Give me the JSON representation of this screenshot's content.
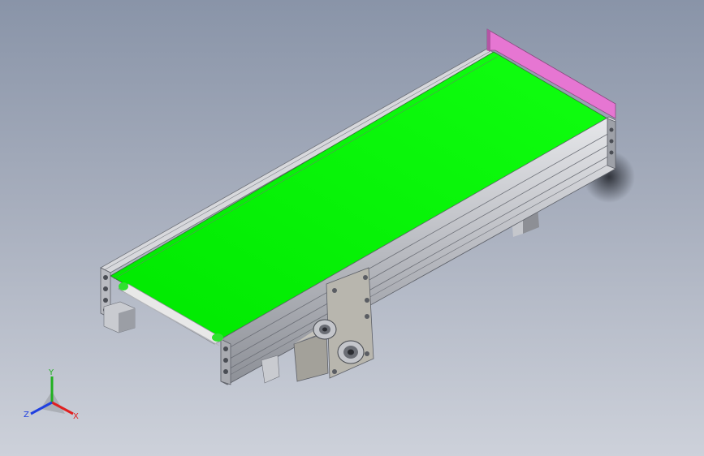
{
  "viewport": {
    "background_top": "#8994a8",
    "background_bottom": "#cdd1da"
  },
  "model": {
    "belt_color": "#00f000",
    "end_guard_color": "#e874d4",
    "frame_color": "#c9cbd0",
    "motor_color": "#b3b0a8"
  },
  "triad": {
    "x_label": "X",
    "y_label": "Y",
    "z_label": "Z",
    "x_color": "#e02020",
    "y_color": "#20b020",
    "z_color": "#2040e0"
  }
}
